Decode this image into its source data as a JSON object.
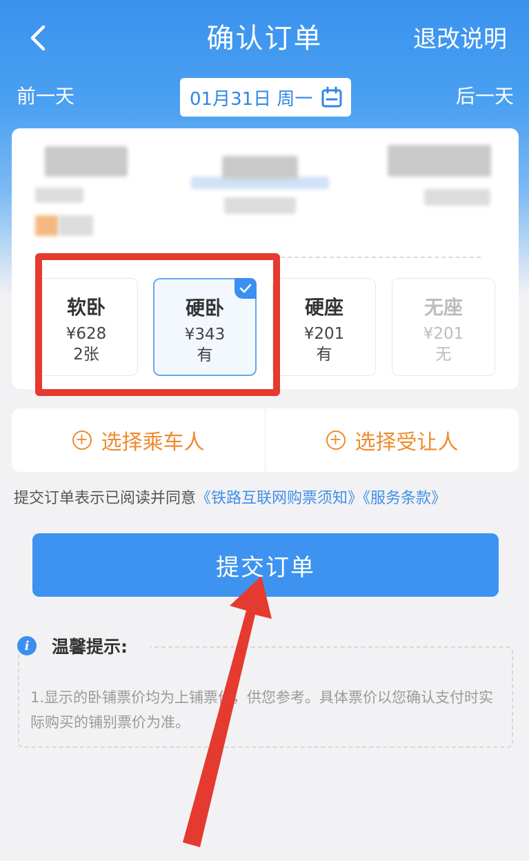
{
  "header": {
    "title": "确认订单",
    "right_link": "退改说明"
  },
  "date_bar": {
    "prev_label": "前一天",
    "date_text": "01月31日 周一",
    "next_label": "后一天"
  },
  "seats": [
    {
      "name": "软卧",
      "price": "¥628",
      "availability": "2张",
      "state": "normal"
    },
    {
      "name": "硬卧",
      "price": "¥343",
      "availability": "有",
      "state": "selected"
    },
    {
      "name": "硬座",
      "price": "¥201",
      "availability": "有",
      "state": "normal"
    },
    {
      "name": "无座",
      "price": "¥201",
      "availability": "无",
      "state": "disabled"
    }
  ],
  "passengers": {
    "select_passenger": "选择乘车人",
    "select_beneficiary": "选择受让人"
  },
  "agreement": {
    "text": "提交订单表示已阅读并同意",
    "link1": "《铁路互联网购票须知》",
    "link2": "《服务条款》"
  },
  "submit_label": "提交订单",
  "tips": {
    "title": "温馨提示:",
    "text": "1.显示的卧铺票价均为上铺票价，供您参考。具体票价以您确认支付时实际购买的铺别票价为准。"
  },
  "colors": {
    "primary": "#3d93ef",
    "accent": "#ef8b2c",
    "annotation": "#e53a2f"
  }
}
